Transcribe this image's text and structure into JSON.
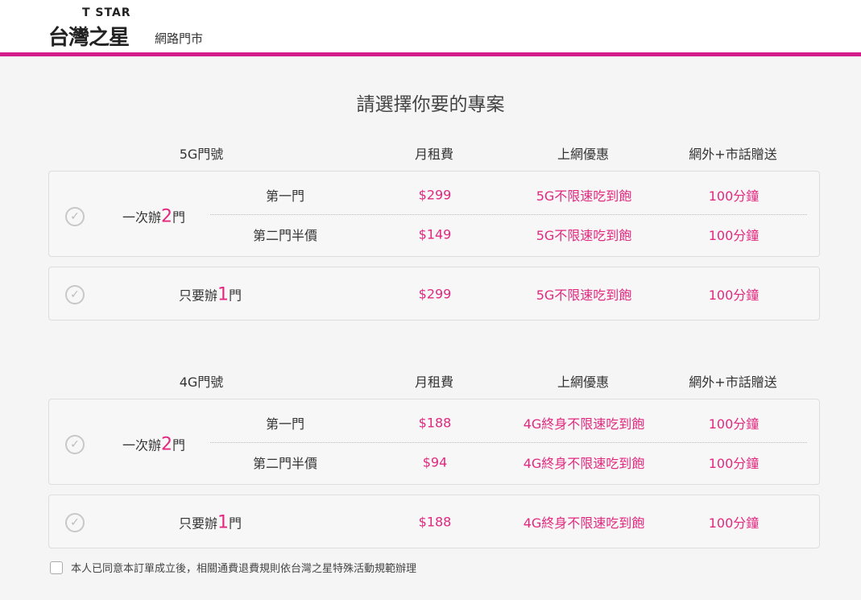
{
  "header": {
    "logo_en": "T STAR",
    "logo_zh": "台灣之星",
    "subtitle": "網路門市"
  },
  "title": "請選擇你要的專案",
  "sections": [
    {
      "columns": [
        "5G門號",
        "月租費",
        "上網優惠",
        "網外+市話贈送"
      ],
      "plans": [
        {
          "label_pre": "一次辦",
          "label_num": "2",
          "label_post": "門",
          "rows": [
            {
              "name": "第一門",
              "price": "$299",
              "data": "5G不限速吃到飽",
              "minutes": "100分鐘"
            },
            {
              "name": "第二門半價",
              "price": "$149",
              "data": "5G不限速吃到飽",
              "minutes": "100分鐘"
            }
          ]
        },
        {
          "label_pre": "只要辦",
          "label_num": "1",
          "label_post": "門",
          "price": "$299",
          "data": "5G不限速吃到飽",
          "minutes": "100分鐘"
        }
      ]
    },
    {
      "columns": [
        "4G門號",
        "月租費",
        "上網優惠",
        "網外+市話贈送"
      ],
      "plans": [
        {
          "label_pre": "一次辦",
          "label_num": "2",
          "label_post": "門",
          "rows": [
            {
              "name": "第一門",
              "price": "$188",
              "data": "4G終身不限速吃到飽",
              "minutes": "100分鐘"
            },
            {
              "name": "第二門半價",
              "price": "$94",
              "data": "4G終身不限速吃到飽",
              "minutes": "100分鐘"
            }
          ]
        },
        {
          "label_pre": "只要辦",
          "label_num": "1",
          "label_post": "門",
          "price": "$188",
          "data": "4G終身不限速吃到飽",
          "minutes": "100分鐘"
        }
      ]
    }
  ],
  "agreement": "本人已同意本訂單成立後，相關通費退費規則依台灣之星特殊活動規範辦理",
  "colors": {
    "accent": "#e2287f",
    "bar": "#d41c8a"
  }
}
